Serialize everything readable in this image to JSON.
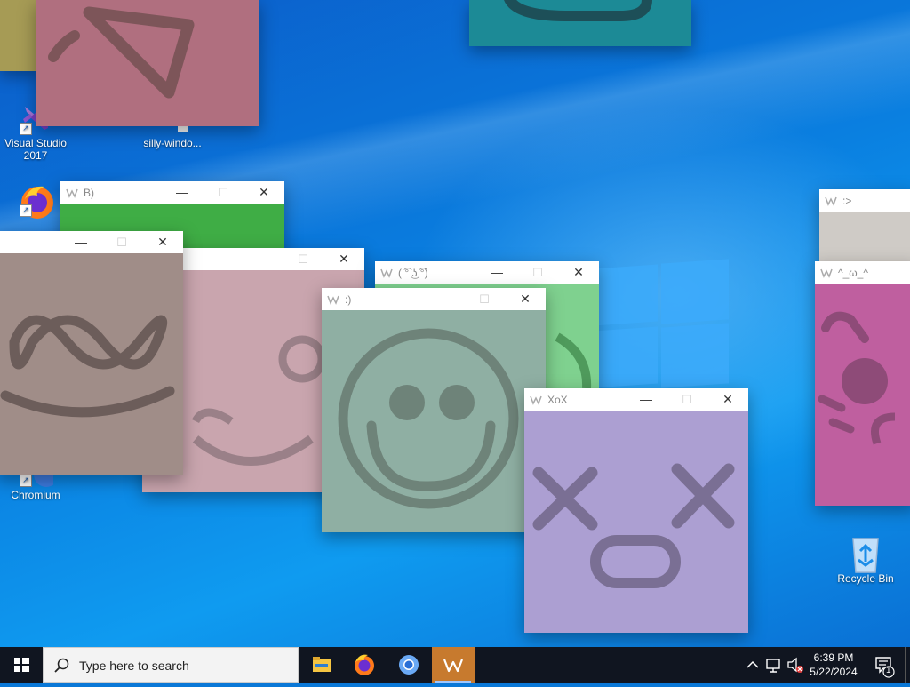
{
  "desktop": {
    "icons": [
      {
        "label": "Visual Studio 2017",
        "line1": "Visual Studio",
        "line2": "2017",
        "icon": "visual-studio-icon"
      },
      {
        "label": "silly-windo...",
        "icon": "file-icon"
      },
      {
        "label": "",
        "icon": "firefox-icon"
      },
      {
        "label": "Chromium",
        "icon": "chromium-icon"
      },
      {
        "label": "Recycle Bin",
        "icon": "recycle-bin-icon"
      }
    ]
  },
  "windows": [
    {
      "title": "",
      "color": "#b06f7f"
    },
    {
      "title": "",
      "color": "#1c8a96"
    },
    {
      "title": "B)",
      "color": "#3fad45"
    },
    {
      "title": "",
      "color": "#c9a5ae"
    },
    {
      "title": "",
      "color": "#a08d88"
    },
    {
      "title": "( ͡° ͜ʖ ͡°)",
      "color": "#7fd18f"
    },
    {
      "title": ":)",
      "color": "#8fafa3"
    },
    {
      "title": "XoX",
      "color": "#ac9fd2"
    },
    {
      "title": ":>",
      "color": "#cfcbc6"
    },
    {
      "title": "^_ω_^",
      "color": "#bf5f9f"
    }
  ],
  "window_controls": {
    "minimize": "—",
    "maximize": "☐",
    "close": "✕"
  },
  "taskbar": {
    "search_placeholder": "Type here to search",
    "apps": [
      "file-explorer-icon",
      "firefox-icon",
      "chromium-icon",
      "silly-windows-icon"
    ],
    "active_app": "silly-windows-icon",
    "clock_time": "6:39 PM",
    "clock_date": "5/22/2024",
    "notification_count": "1"
  },
  "colors": {
    "taskbar": "#101520",
    "accent": "#c77a2e"
  }
}
